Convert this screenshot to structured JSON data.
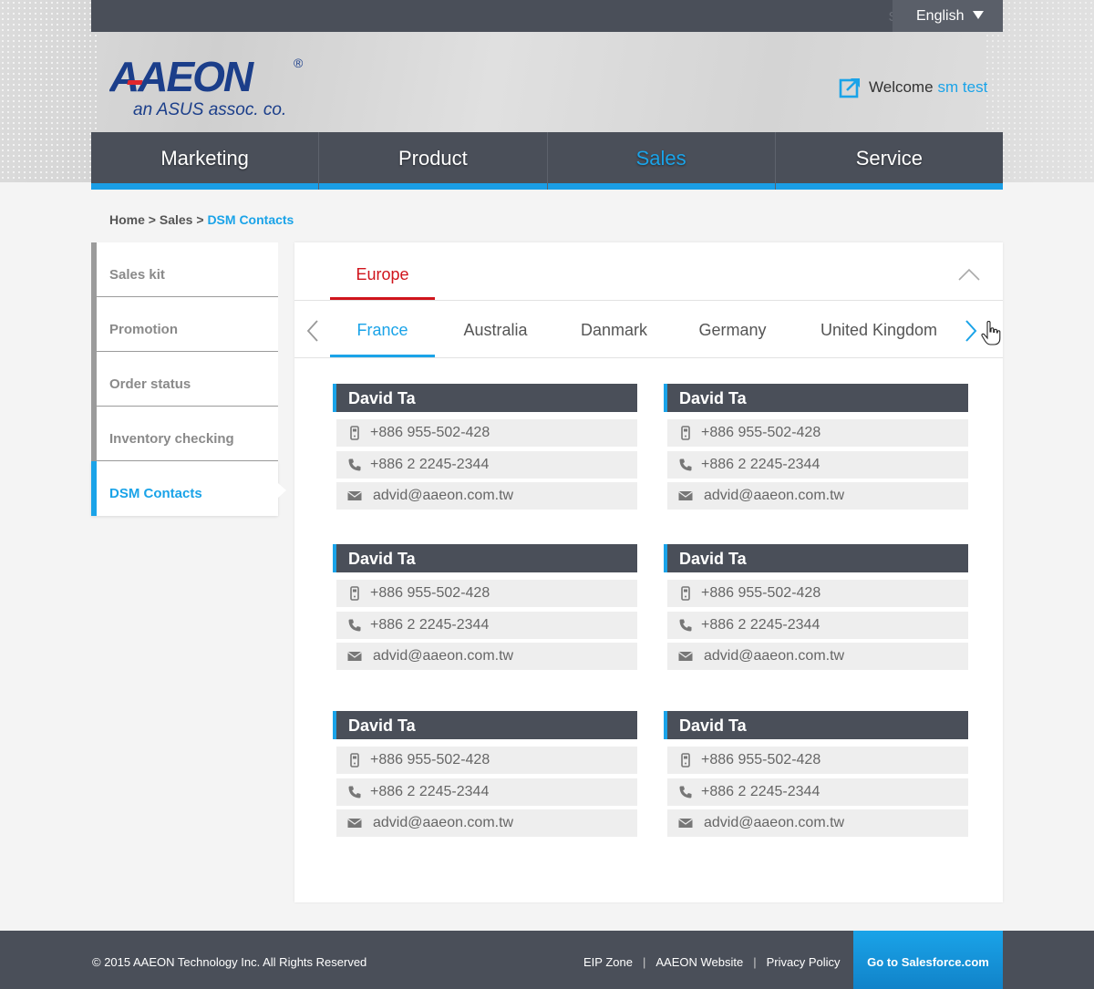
{
  "header": {
    "search_placeholder": "Search",
    "language": "English",
    "logo_brand": "AAEON",
    "logo_tagline": "an ASUS assoc. co.",
    "welcome_label": "Welcome",
    "welcome_user": "sm test"
  },
  "nav": {
    "items": [
      {
        "label": "Marketing"
      },
      {
        "label": "Product"
      },
      {
        "label": "Sales",
        "active": true
      },
      {
        "label": "Service"
      }
    ]
  },
  "breadcrumb": {
    "home": "Home",
    "sep1": ">",
    "section": "Sales",
    "sep2": ">",
    "current": "DSM Contacts"
  },
  "sidebar": {
    "items": [
      {
        "label": "Sales kit"
      },
      {
        "label": "Promotion"
      },
      {
        "label": "Order status"
      },
      {
        "label": "Inventory checking"
      },
      {
        "label": "DSM Contacts",
        "active": true
      }
    ]
  },
  "region": {
    "label": "Europe"
  },
  "countries": [
    {
      "label": "France",
      "active": true
    },
    {
      "label": "Australia"
    },
    {
      "label": "Danmark"
    },
    {
      "label": "Germany"
    },
    {
      "label": "United Kingdom"
    }
  ],
  "contacts": [
    {
      "name": "David Ta",
      "mobile": "+886 955-502-428",
      "phone": "+886 2 2245-2344",
      "email": "advid@aaeon.com.tw"
    },
    {
      "name": "David Ta",
      "mobile": "+886 955-502-428",
      "phone": "+886 2 2245-2344",
      "email": "advid@aaeon.com.tw"
    },
    {
      "name": "David Ta",
      "mobile": "+886 955-502-428",
      "phone": "+886 2 2245-2344",
      "email": "advid@aaeon.com.tw"
    },
    {
      "name": "David Ta",
      "mobile": "+886 955-502-428",
      "phone": "+886 2 2245-2344",
      "email": "advid@aaeon.com.tw"
    },
    {
      "name": "David Ta",
      "mobile": "+886 955-502-428",
      "phone": "+886 2 2245-2344",
      "email": "advid@aaeon.com.tw"
    },
    {
      "name": "David Ta",
      "mobile": "+886 955-502-428",
      "phone": "+886 2 2245-2344",
      "email": "advid@aaeon.com.tw"
    }
  ],
  "footer": {
    "copyright": "© 2015 AAEON Technology Inc. All Rights Reserved",
    "links": [
      "EIP Zone",
      "AAEON Website",
      "Privacy Policy"
    ],
    "separator": "|",
    "salesforce_button": "Go to Salesforce.com"
  },
  "colors": {
    "accent": "#1aa3e8",
    "dark": "#4a4f59",
    "region_red": "#d0141c"
  }
}
